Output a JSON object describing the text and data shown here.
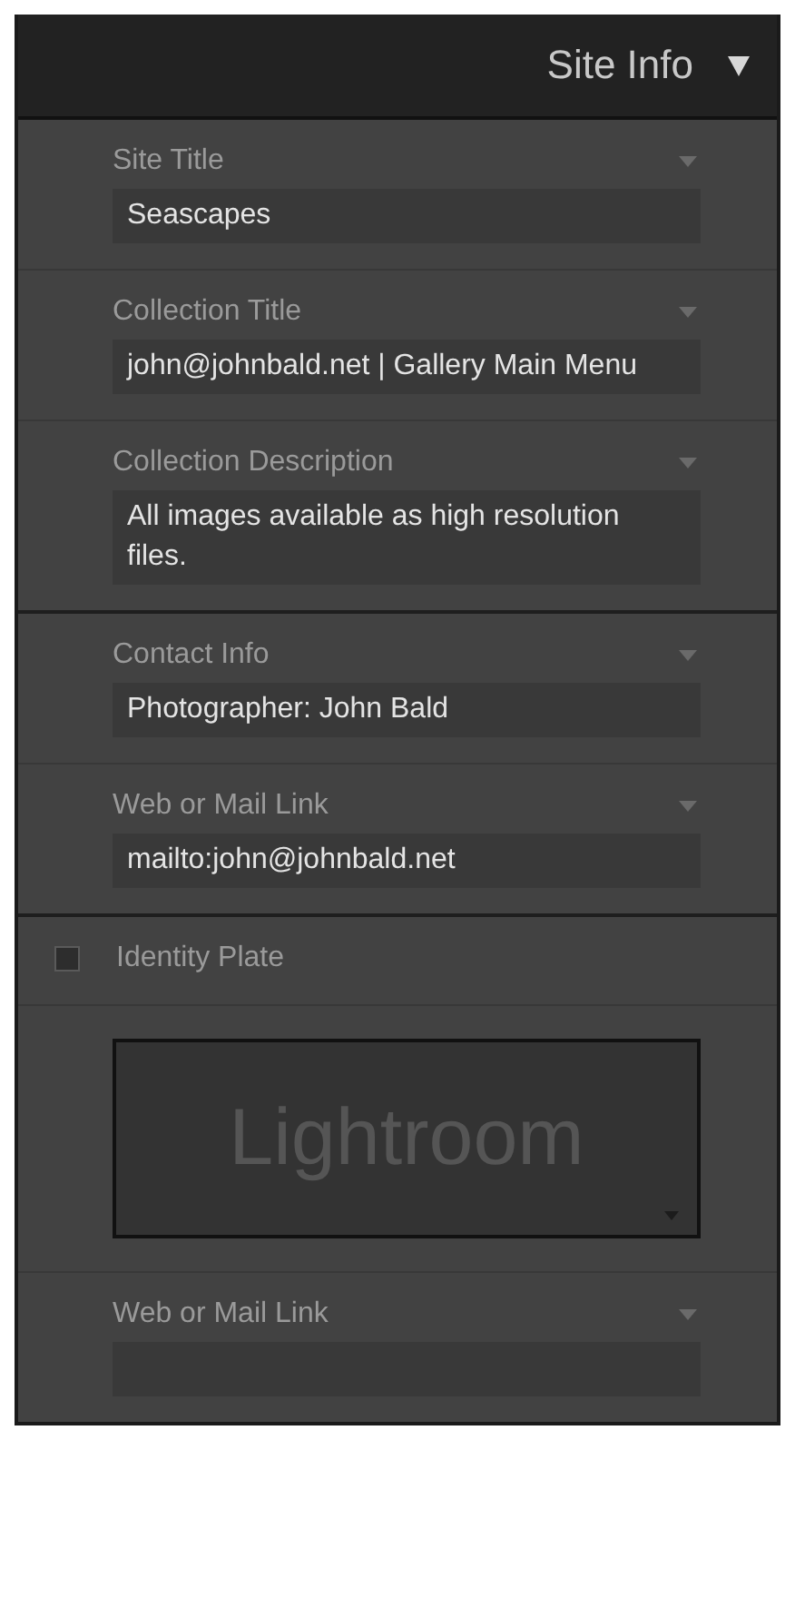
{
  "panel": {
    "title": "Site Info",
    "expanded": true
  },
  "groups": [
    {
      "items": [
        {
          "kind": "field",
          "label": "Site Title",
          "value": "Seascapes"
        },
        {
          "kind": "field",
          "label": "Collection Title",
          "value": "john@johnbald.net | Gallery Main Menu"
        },
        {
          "kind": "field",
          "label": "Collection Description",
          "value": "All images available as high resolution files."
        }
      ]
    },
    {
      "items": [
        {
          "kind": "field",
          "label": "Contact Info",
          "value": "Photographer: John Bald"
        },
        {
          "kind": "field",
          "label": "Web or Mail Link",
          "value": "mailto:john@johnbald.net"
        }
      ]
    },
    {
      "items": [
        {
          "kind": "checkbox",
          "label": "Identity Plate",
          "checked": false
        },
        {
          "kind": "plate",
          "text": "Lightroom"
        },
        {
          "kind": "field",
          "label": "Web or Mail Link",
          "value": ""
        }
      ]
    }
  ]
}
